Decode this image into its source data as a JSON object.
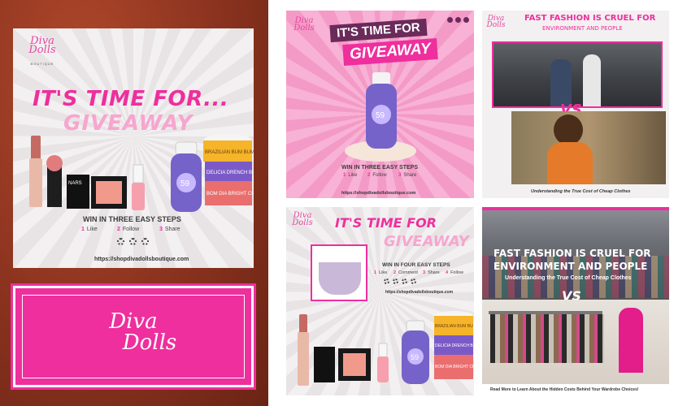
{
  "brand": {
    "logo_line1": "Diva",
    "logo_line2": "Dolls",
    "logo_sub": "BOUTIQUE",
    "big_logo_line1": "Diva",
    "big_logo_line2": "Dolls"
  },
  "giveaway_large": {
    "title1": "IT'S TIME FOR...",
    "title2": "GIVEAWAY",
    "steps_heading": "WIN IN THREE EASY STEPS",
    "steps": [
      {
        "num": "1",
        "label": "Like"
      },
      {
        "num": "2",
        "label": "Follow"
      },
      {
        "num": "3",
        "label": "Share"
      }
    ],
    "url": "https://shopdivadollsboutique.com",
    "jar_labels": [
      "BRAZILIAN BUM BUM C",
      "DELICIA DRENCH BU",
      "BOM DIA BRIGHT CRE"
    ],
    "bottle_label": "59",
    "compact_label": "NARS"
  },
  "giveaway_pink": {
    "title1": "IT'S TIME FOR",
    "title2": "GIVEAWAY",
    "steps_heading": "WIN IN THREE EASY STEPS",
    "steps": [
      {
        "num": "1",
        "label": "Like"
      },
      {
        "num": "2",
        "label": "Follow"
      },
      {
        "num": "3",
        "label": "Share"
      }
    ],
    "url": "https://shopdivadollsboutique.com",
    "bottle_label": "59"
  },
  "fast_fashion_1": {
    "title1": "FAST FASHION IS CRUEL FOR",
    "title2": "ENVIRONMENT AND PEOPLE",
    "vs": "VS",
    "caption": "Understanding the True Cost of Cheap Clothes"
  },
  "giveaway_four": {
    "title1": "IT'S TIME FOR",
    "title2": "GIVEAWAY",
    "steps_heading": "WIN IN FOUR EASY STEPS",
    "steps": [
      {
        "num": "1",
        "label": "Like"
      },
      {
        "num": "2",
        "label": "Comment"
      },
      {
        "num": "3",
        "label": "Share"
      },
      {
        "num": "4",
        "label": "Follow"
      }
    ],
    "url": "https://shopdivadollsboutique.com",
    "jar_labels": [
      "BRAZILIAN BUM BUM C",
      "DELICIA DRENCH BU",
      "BOM DIA BRIGHT CRE"
    ],
    "bottle_label": "59"
  },
  "fast_fashion_2": {
    "title1": "FAST FASHION IS CRUEL FOR",
    "title2": "ENVIRONMENT AND PEOPLE",
    "subtitle": "Understanding the True Cost of Cheap Clothes",
    "vs": "VS",
    "footer": "Read More to Learn About the Hidden Costs Behind Your Wardrobe Choices!"
  },
  "colors": {
    "brand_pink": "#ee2f9d",
    "light_pink": "#f6a6cf",
    "panel_brown": "#8d3420",
    "dark_plum": "#6a2a5a"
  }
}
